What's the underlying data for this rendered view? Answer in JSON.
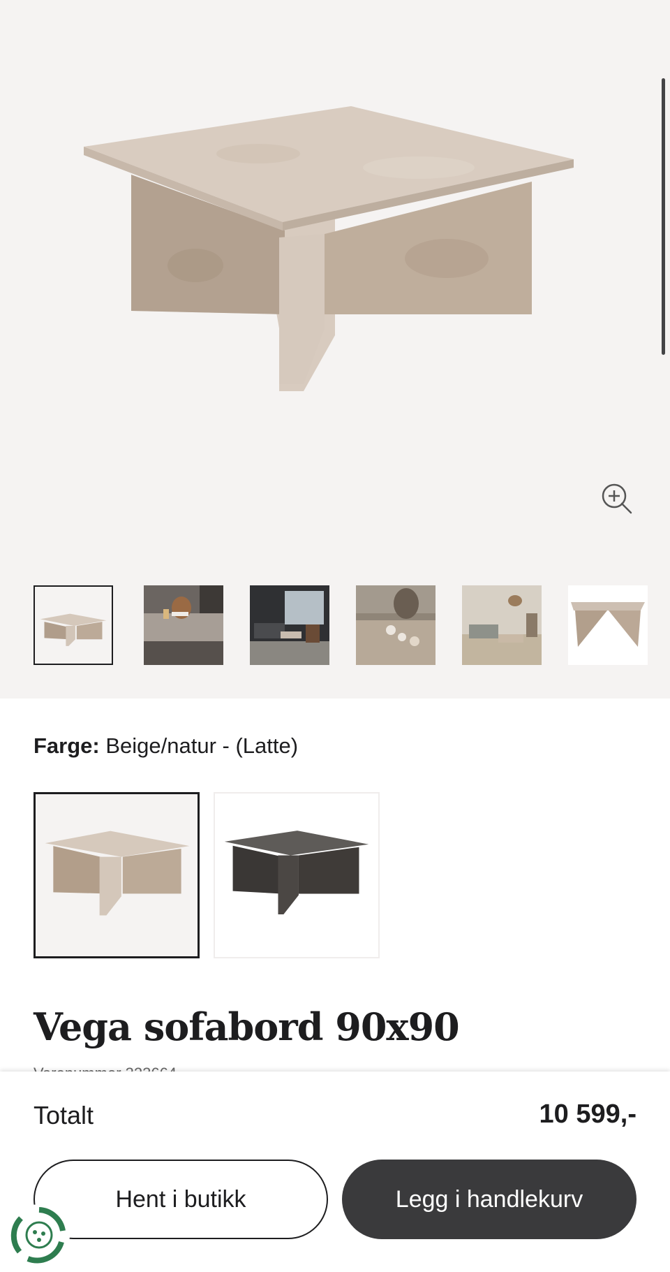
{
  "gallery": {
    "main_image_alt": "",
    "zoom_icon": "zoom-in-icon",
    "thumbnails": [
      {
        "name": "thumb-product",
        "active": true
      },
      {
        "name": "thumb-detail-candles",
        "active": false
      },
      {
        "name": "thumb-living-room-dark",
        "active": false
      },
      {
        "name": "thumb-detail-vase",
        "active": false
      },
      {
        "name": "thumb-living-room-light",
        "active": false
      },
      {
        "name": "thumb-product-side",
        "active": false
      }
    ]
  },
  "color": {
    "label": "Farge:",
    "value": "Beige/natur - (Latte)",
    "swatches": [
      {
        "name": "beige",
        "active": true
      },
      {
        "name": "dark",
        "active": false
      }
    ]
  },
  "product": {
    "title": "Vega sofabord 90x90",
    "article_number": "Varenummer 323664"
  },
  "bottom_bar": {
    "total_label": "Totalt",
    "total_price": "10 599,-",
    "store_button": "Hent i butikk",
    "cart_button": "Legg i handlekurv"
  },
  "colors": {
    "gallery_bg": "#f5f3f2",
    "dark": "#1d1d1f",
    "cart_button": "#3a3a3c",
    "badge_green": "#2e7d4f"
  }
}
